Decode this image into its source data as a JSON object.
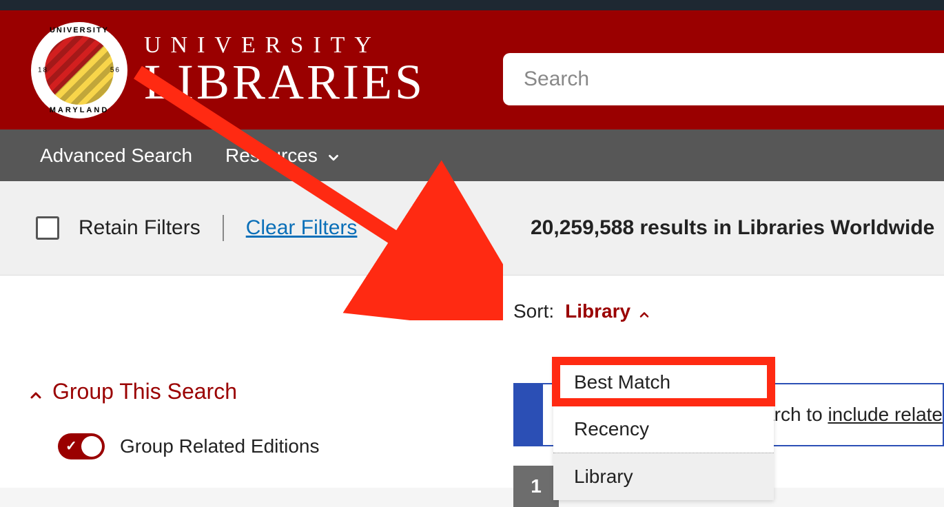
{
  "header": {
    "logo_line1": "UNIVERSITY",
    "logo_line2": "LIBRARIES",
    "seal_top": "UNIVERSITY",
    "seal_bottom": "MARYLAND",
    "seal_left": "18",
    "seal_right": "56",
    "search_placeholder": "Search"
  },
  "nav": {
    "advanced": "Advanced Search",
    "resources": "Resources"
  },
  "filters": {
    "retain": "Retain Filters",
    "clear": "Clear Filters",
    "results": "20,259,588 results in Libraries Worldwide"
  },
  "sort": {
    "label": "Sort:",
    "value": "Library",
    "options": [
      "Best Match",
      "Recency",
      "Library"
    ],
    "selected_index": 2
  },
  "panel": {
    "hint_prefix": "arch to ",
    "hint_link": "include relate"
  },
  "group": {
    "heading": "Group This Search",
    "toggle_label": "Group Related Editions"
  },
  "result": {
    "first_number": "1"
  }
}
